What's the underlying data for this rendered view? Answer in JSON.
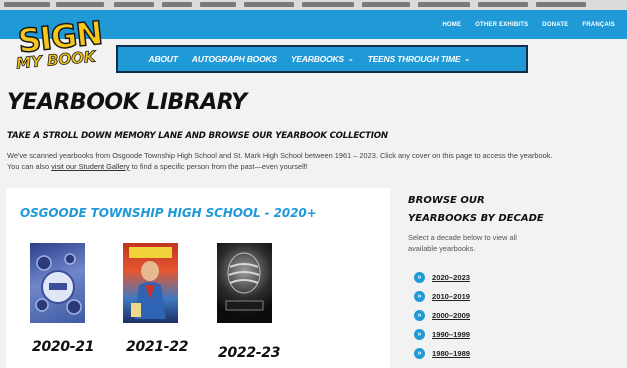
{
  "top_links": [
    "HOME",
    "OTHER EXHIBITS",
    "DONATE",
    "FRANÇAIS"
  ],
  "logo": {
    "line1": "SIGN",
    "line2": "MY BOOK"
  },
  "nav": [
    {
      "label": "ABOUT",
      "has_dropdown": false
    },
    {
      "label": "AUTOGRAPH BOOKS",
      "has_dropdown": false
    },
    {
      "label": "YEARBOOKS",
      "has_dropdown": true
    },
    {
      "label": "TEENS THROUGH TIME",
      "has_dropdown": true
    }
  ],
  "page": {
    "title": "YEARBOOK LIBRARY",
    "subtitle": "TAKE A STROLL DOWN MEMORY LANE AND BROWSE OUR YEARBOOK COLLECTION",
    "intro_before": "We've scanned yearbooks from Osgoode Township High School and St. Mark High School between 1961 – 2023. Click any cover on this page to access the yearbook. You can also ",
    "intro_link": "visit our Student Gallery",
    "intro_after": " to find a specific person from the past—even yourself!"
  },
  "section": {
    "title": "OSGOODE TOWNSHIP HIGH SCHOOL - 2020+",
    "yearbooks": [
      {
        "year": "2020-21"
      },
      {
        "year": "2021-22"
      },
      {
        "year": "2022-23"
      }
    ]
  },
  "sidebar": {
    "title_line1": "BROWSE OUR",
    "title_line2": "YEARBOOKS BY DECADE",
    "text": "Select a decade below to view all available yearbooks.",
    "decades": [
      "2020–2023",
      "2010–2019",
      "2000–2009",
      "1990–1999",
      "1980–1989"
    ]
  },
  "colors": {
    "accent": "#1f9ad6",
    "nav_border": "#0d2d4a",
    "logo_yellow": "#f7c81b"
  },
  "icons": {
    "decade_bullet": "double-chevron-right-icon",
    "dropdown": "chevron-down-icon"
  }
}
